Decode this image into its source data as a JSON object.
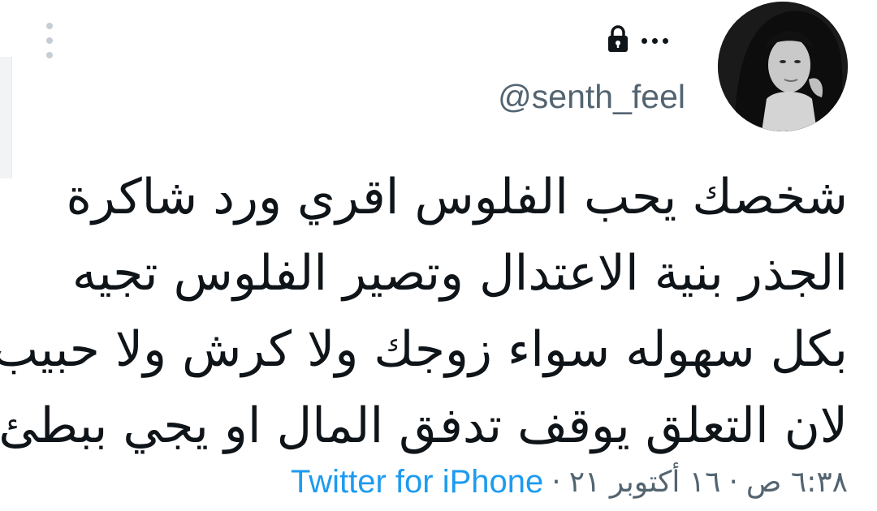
{
  "tweet": {
    "handle": "@senth_feel",
    "text_lines": [
      "شخصك يحب الفلوس اقري ورد شاكرة",
      "الجذر بنية الاعتدال وتصير  الفلوس تجيه",
      "بكل سهوله سواء زوجك ولا كرش ولا حبيب",
      "لان التعلق يوقف تدفق المال او يجي ببطئ"
    ],
    "time": "٦:٣٨ ص",
    "separator": "·",
    "date": "١٦ أكتوبر ٢١",
    "source": "Twitter for iPhone"
  },
  "icons": {
    "lock": "lock-icon",
    "more": "more-horizontal-icon",
    "side_menu": "more-vertical-icon"
  },
  "colors": {
    "link": "#1d9bf0",
    "secondary_text": "#536471",
    "primary_text": "#0f1419"
  }
}
